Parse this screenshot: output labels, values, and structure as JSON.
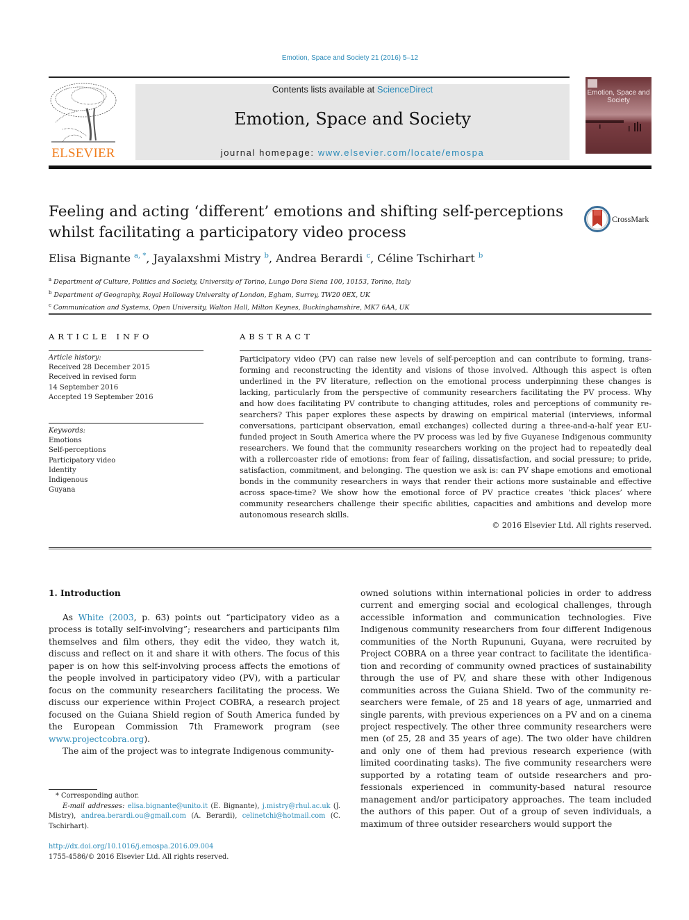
{
  "header": {
    "journal_reference": "Emotion, Space and Society 21 (2016) 5–12",
    "contents_prefix": "Contents lists available at ",
    "contents_link": "ScienceDirect",
    "journal_title": "Emotion, Space and Society",
    "homepage_prefix": "journal homepage: ",
    "homepage_link": "www.elsevier.com/locate/emospa",
    "publisher_logo_text": "ELSEVIER",
    "cover_title": "Emotion, Space and Society",
    "crossmark_label": "CrossMark"
  },
  "colors": {
    "link": "#2a8ab8",
    "elsevier_orange": "#f07d1d",
    "masthead_bg": "#e6e6e6",
    "cover_bg": "#8a4a4e"
  },
  "article": {
    "title_line1": "Feeling and acting ‘different’ emotions and shifting self-perceptions",
    "title_line2": "whilst facilitating a participatory video process",
    "authors": [
      {
        "name": "Elisa Bignante",
        "sup": "a, *"
      },
      {
        "name": "Jayalaxshmi Mistry",
        "sup": "b"
      },
      {
        "name": "Andrea Berardi",
        "sup": "c"
      },
      {
        "name": "Céline Tschirhart",
        "sup": "b"
      }
    ],
    "affiliations": [
      {
        "label": "a",
        "text": "Department of Culture, Politics and Society, University of Torino, Lungo Dora Siena 100, 10153, Torino, Italy"
      },
      {
        "label": "b",
        "text": "Department of Geography, Royal Holloway University of London, Egham, Surrey, TW20 0EX, UK"
      },
      {
        "label": "c",
        "text": "Communication and Systems, Open University, Walton Hall, Milton Keynes, Buckinghamshire, MK7 6AA, UK"
      }
    ]
  },
  "article_info": {
    "heading": "ARTICLE INFO",
    "history_label": "Article history:",
    "history": [
      "Received 28 December 2015",
      "Received in revised form",
      "14 September 2016",
      "Accepted 19 September 2016"
    ],
    "keywords_label": "Keywords:",
    "keywords": [
      "Emotions",
      "Self-perceptions",
      "Participatory video",
      "Identity",
      "Indigenous",
      "Guyana"
    ]
  },
  "abstract": {
    "heading": "ABSTRACT",
    "text": "Participatory video (PV) can raise new levels of self-perception and can contribute to forming, trans­forming and reconstructing the identity and visions of those involved. Although this aspect is often underlined in the PV literature, reflection on the emotional process underpinning these changes is lacking, particularly from the perspective of community researchers facilitating the PV process. Why and how does facilitating PV contribute to changing attitudes, roles and perceptions of community re­searchers? This paper explores these aspects by drawing on empirical material (interviews, informal conversations, participant observation, email exchanges) collected during a three-and-a-half year EU-funded project in South America where the PV process was led by five Guyanese Indigenous commu­nity researchers. We found that the community researchers working on the project had to repeatedly deal with a rollercoaster ride of emotions: from fear of failing, dissatisfaction, and social pressure; to pride, satisfaction, commitment, and belonging. The question we ask is: can PV shape emotions and emotional bonds in the community researchers in ways that render their actions more sustainable and effective across space-time? We show how the emotional force of PV practice creates ‘thick places’ where community researchers challenge their specific abilities, capacities and ambitions and develop more autonomous research skills.",
    "copyright": "© 2016 Elsevier Ltd. All rights reserved."
  },
  "introduction": {
    "heading": "1.  Introduction",
    "p1_prefix": "As ",
    "p1_cite_author": "White (2003",
    "p1_after_cite": ", p. 63) points out “participatory video as a process is totally self-involving”; researchers and participants film themselves and film others, they edit the video, they watch it, discuss and reflect on it and share it with others. The focus of this paper is on how this self-involving process affects the emotions of the people involved in participatory video (PV), with a particular focus on the community researchers facilitating the process. We discuss our experience within Project COBRA, a research project focused on the Guiana Shield region of South America funded by the European Commission 7th Framework program (see ",
    "p1_link": "www.projectcobra.org",
    "p1_suffix": ").",
    "p2": "The aim of the project was to integrate Indigenous community-",
    "col2": "owned solutions within international policies in order to address current and emerging social and ecological challenges, through accessible information and communication technologies. Five Indigenous community researchers from four different Indigenous communities of the North Rupununi, Guyana, were recruited by Project COBRA on a three year contract to facilitate the identifica­tion and recording of community owned practices of sustainability through the use of PV, and share these with other Indigenous communities across the Guiana Shield. Two of the community re­searchers were female, of 25 and 18 years of age, unmarried and single parents, with previous experiences on a PV and on a cinema project respectively. The other three community researchers were men (of 25, 28 and 35 years of age). The two older have children and only one of them had previous research experience (with limited coordinating tasks). The five community researchers were supported by a rotating team of outside researchers and pro­fessionals experienced in community-based natural resource management and/or participatory approaches. The team included the authors of this paper. Out of a group of seven individuals, a maximum of three outsider researchers would support the"
  },
  "footnotes": {
    "corresponding": "* Corresponding author.",
    "email_label": "E-mail addresses:",
    "emails": [
      {
        "email": "elisa.bignante@unito.it",
        "name": "(E. Bignante),"
      },
      {
        "email": "j.mistry@rhul.ac.uk",
        "name": "(J. Mistry),"
      },
      {
        "email": "andrea.berardi.ou@gmail.com",
        "name": "(A. Berardi),"
      },
      {
        "email": "celinetchi@hotmail.com",
        "name": "(C. Tschirhart)."
      }
    ],
    "doi": "http://dx.doi.org/10.1016/j.emospa.2016.09.004",
    "issn_copyright": "1755-4586/© 2016 Elsevier Ltd. All rights reserved."
  }
}
